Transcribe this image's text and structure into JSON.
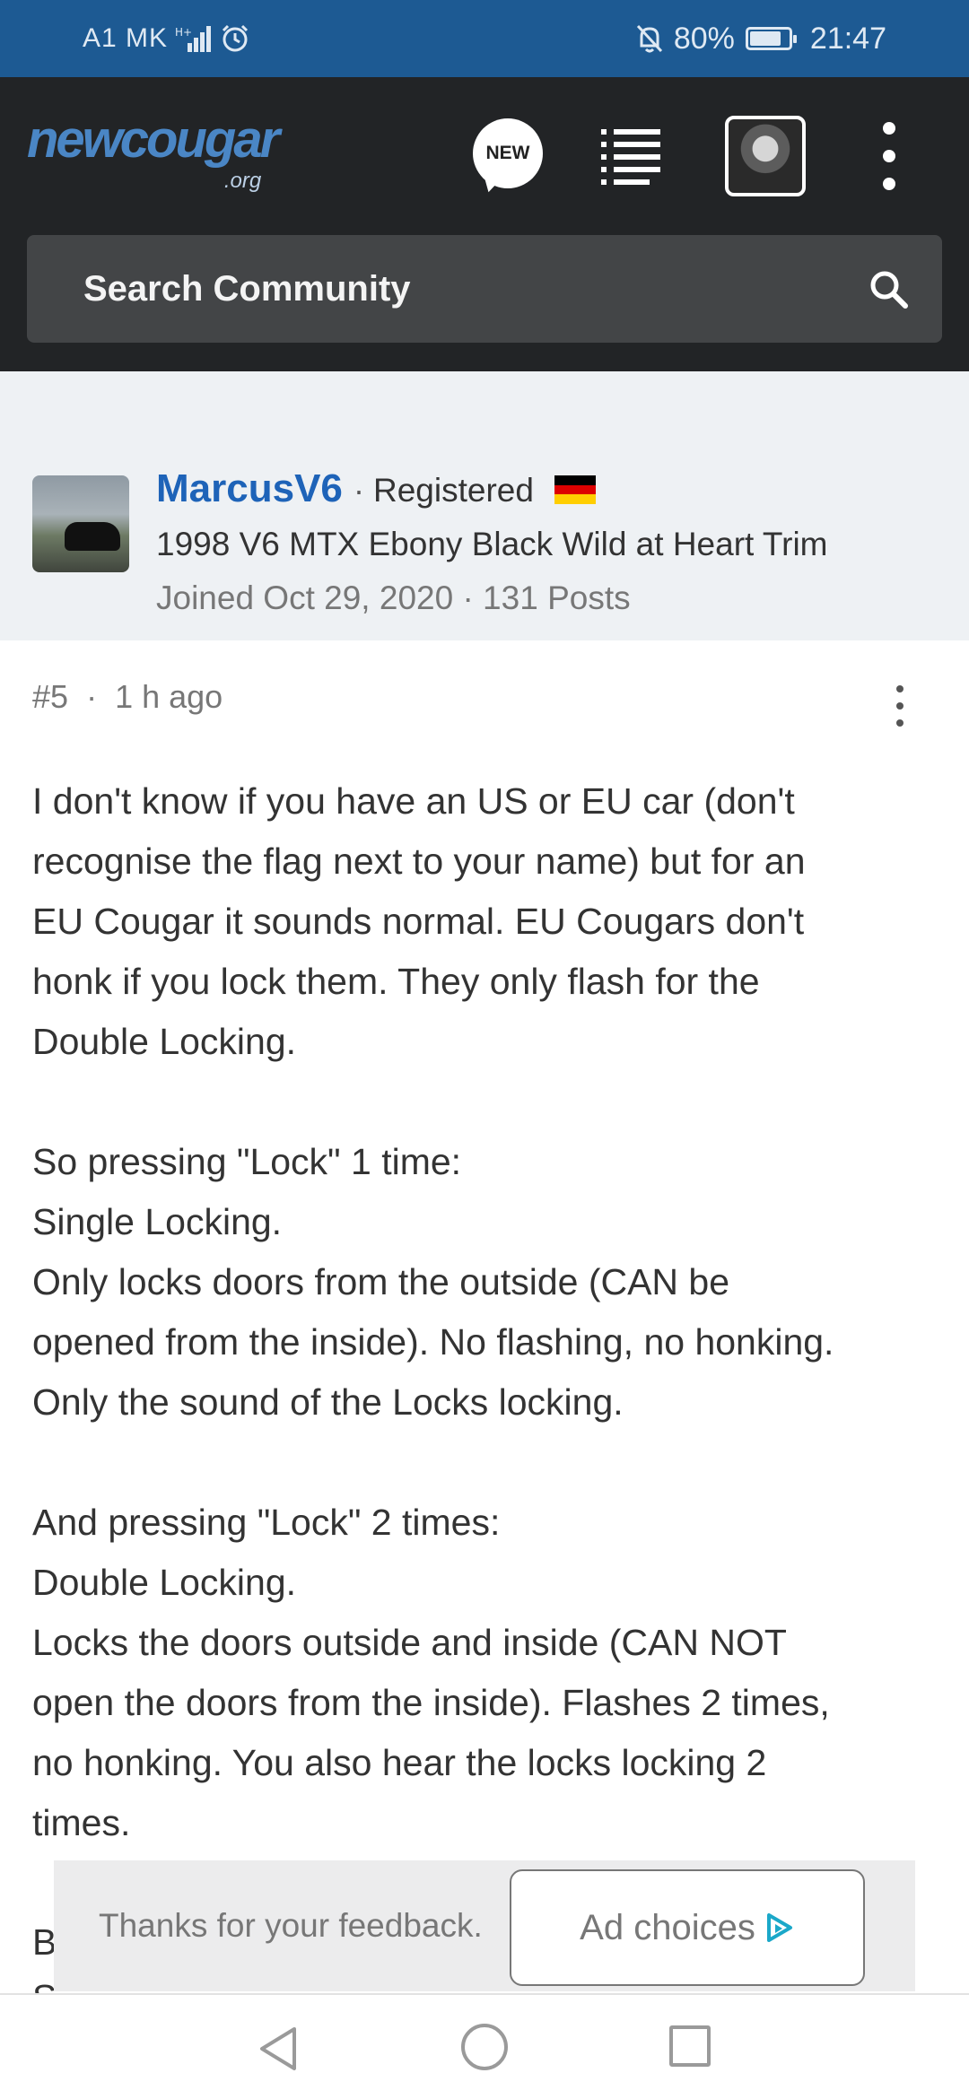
{
  "status_bar": {
    "carrier": "A1 MK",
    "battery": "80%",
    "battery_level": 0.8,
    "time": "21:47",
    "icons": [
      "signal-icon",
      "alarm-icon",
      "mute-icon",
      "battery-icon"
    ]
  },
  "header": {
    "logo_main": "newcougar",
    "logo_suffix": ".org",
    "new_label": "NEW",
    "search_placeholder": "Search Community"
  },
  "author": {
    "name": "MarcusV6",
    "separator": "·",
    "role": "Registered",
    "car": "1998 V6 MTX Ebony Black Wild at Heart Trim",
    "meta": "Joined Oct 29, 2020 · 131 Posts",
    "flag_colors": [
      "#000000",
      "#dd0000",
      "#ffce00"
    ]
  },
  "post": {
    "number": "#5",
    "separator": "·",
    "time": "1 h ago",
    "paragraphs": [
      "I don't know if you have an US or EU car (don't\nrecognise the flag next to your name) but for an\nEU Cougar it sounds normal. EU Cougars don't\nhonk if you lock them. They only flash for the\nDouble Locking.",
      "So pressing \"Lock\" 1 time:\nSingle Locking.\nOnly locks doors from the outside (CAN be\nopened from the inside). No flashing, no honking.\nOnly the sound of the Locks locking.",
      "And pressing \"Lock\" 2 times:\nDouble Locking.\nLocks the doors outside and inside (CAN NOT\nopen the doors from the inside). Flashes 2 times,\nno honking. You also hear the locks locking 2\ntimes."
    ],
    "cut_line_1": "B",
    "cut_line_2": "S"
  },
  "ad": {
    "feedback": "Thanks for your feedback.",
    "choices": "Ad choices"
  },
  "colors": {
    "status_bar": "#1d5a93",
    "header": "#222426",
    "brand_blue": "#4a86c5",
    "author_name": "#1e63b8",
    "author_bg": "#eef1f4",
    "ad_choices_icon": "#1ba8c9"
  }
}
